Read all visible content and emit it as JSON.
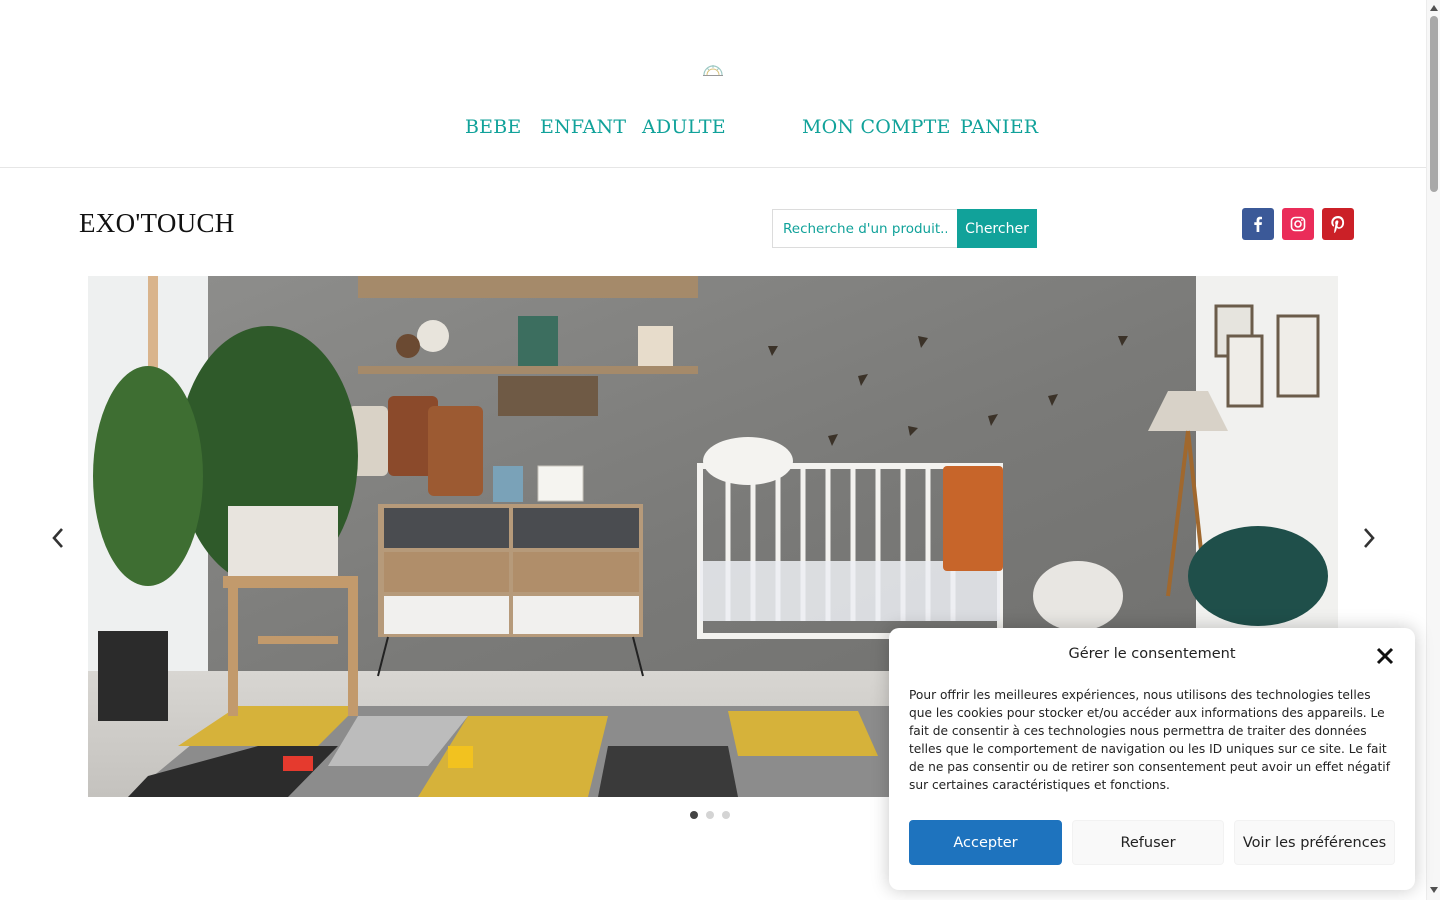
{
  "nav": {
    "items": [
      "BEBE",
      "ENFANT",
      "ADULTE",
      "MON COMPTE",
      "PANIER"
    ]
  },
  "header": {
    "site_title": "EXO'TOUCH"
  },
  "search": {
    "placeholder": "Recherche d'un produit...",
    "button_label": "Chercher"
  },
  "social": [
    {
      "name": "facebook-icon",
      "color": "#3b5998"
    },
    {
      "name": "instagram-icon",
      "color": "#ea2c59"
    },
    {
      "name": "pinterest-icon",
      "color": "#cb2027"
    }
  ],
  "slider": {
    "image": "nursery-room-photo",
    "dots": 3,
    "active_dot": 1
  },
  "consent": {
    "title": "Gérer le consentement",
    "text": "Pour offrir les meilleures expériences, nous utilisons des technologies telles que les cookies pour stocker et/ou accéder aux informations des appareils. Le fait de consentir à ces technologies nous permettra de traiter des données telles que le comportement de navigation ou les ID uniques sur ce site. Le fait de ne pas consentir ou de retirer son consentement peut avoir un effet négatif sur certaines caractéristiques et fonctions.",
    "accept_label": "Accepter",
    "refuse_label": "Refuser",
    "prefs_label": "Voir les préférences"
  },
  "colors": {
    "accent": "#11a29a",
    "consent_primary": "#1e73be"
  }
}
